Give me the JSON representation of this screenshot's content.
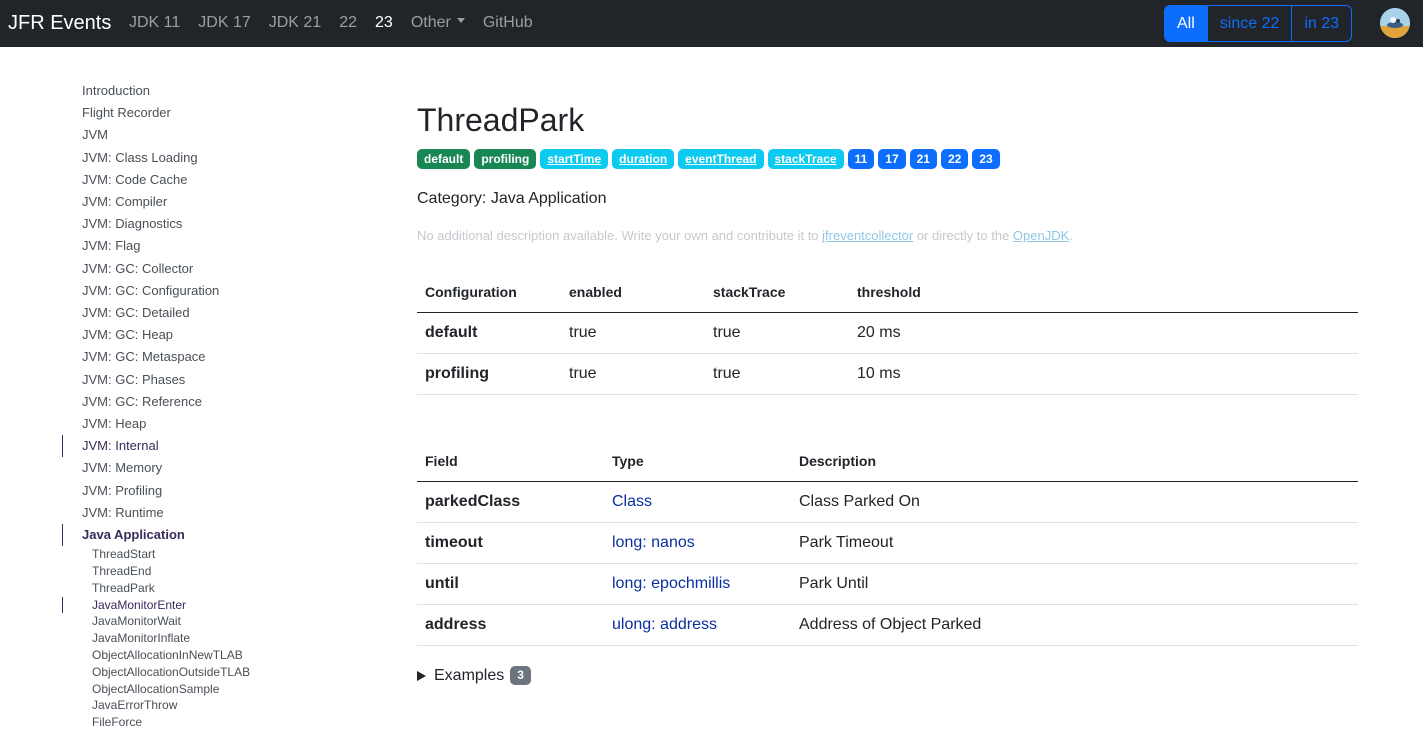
{
  "navbar": {
    "brand": "JFR Events",
    "links": [
      {
        "label": "JDK 11",
        "active": false
      },
      {
        "label": "JDK 17",
        "active": false
      },
      {
        "label": "JDK 21",
        "active": false
      },
      {
        "label": "22",
        "active": false
      },
      {
        "label": "23",
        "active": true
      }
    ],
    "other_label": "Other",
    "github_label": "GitHub",
    "filters": [
      {
        "label": "All",
        "active": true
      },
      {
        "label": "since 22",
        "active": false
      },
      {
        "label": "in 23",
        "active": false
      }
    ]
  },
  "sidebar": {
    "items": [
      "Introduction",
      "Flight Recorder",
      "JVM",
      "JVM: Class Loading",
      "JVM: Code Cache",
      "JVM: Compiler",
      "JVM: Diagnostics",
      "JVM: Flag",
      "JVM: GC: Collector",
      "JVM: GC: Configuration",
      "JVM: GC: Detailed",
      "JVM: GC: Heap",
      "JVM: GC: Metaspace",
      "JVM: GC: Phases",
      "JVM: GC: Reference",
      "JVM: Heap",
      "JVM: Internal",
      "JVM: Memory",
      "JVM: Profiling",
      "JVM: Runtime",
      "Java Application"
    ],
    "sub_items": [
      "ThreadStart",
      "ThreadEnd",
      "ThreadPark",
      "JavaMonitorEnter",
      "JavaMonitorWait",
      "JavaMonitorInflate",
      "ObjectAllocationInNewTLAB",
      "ObjectAllocationOutsideTLAB",
      "ObjectAllocationSample",
      "JavaErrorThrow",
      "FileForce"
    ]
  },
  "main": {
    "title": "ThreadPark",
    "badges": {
      "green": [
        "default",
        "profiling"
      ],
      "cyan": [
        "startTime",
        "duration",
        "eventThread",
        "stackTrace"
      ],
      "blue": [
        "11",
        "17",
        "21",
        "22",
        "23"
      ]
    },
    "category_label": "Category:",
    "category_value": "Java Application",
    "description": {
      "text1": "No additional description available. Write your own and contribute it to ",
      "link1": "jfreventcollector",
      "text2": " or directly to the ",
      "link2": "OpenJDK",
      "text3": "."
    },
    "config_table": {
      "headers": [
        "Configuration",
        "enabled",
        "stackTrace",
        "threshold"
      ],
      "rows": [
        [
          "default",
          "true",
          "true",
          "20 ms"
        ],
        [
          "profiling",
          "true",
          "true",
          "10 ms"
        ]
      ]
    },
    "field_table": {
      "headers": [
        "Field",
        "Type",
        "Description"
      ],
      "rows": [
        [
          "parkedClass",
          "Class",
          "Class Parked On"
        ],
        [
          "timeout",
          "long: nanos",
          "Park Timeout"
        ],
        [
          "until",
          "long: epochmillis",
          "Park Until"
        ],
        [
          "address",
          "ulong: address",
          "Address of Object Parked"
        ]
      ]
    },
    "examples_label": "Examples",
    "examples_count": "3"
  }
}
